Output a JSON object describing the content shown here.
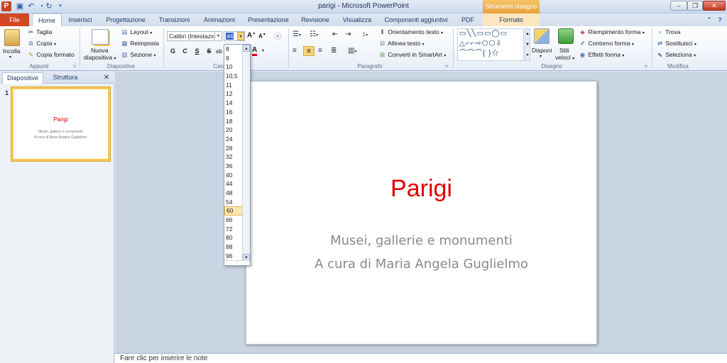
{
  "window": {
    "title": "parigi - Microsoft PowerPoint",
    "context_tool": "Strumenti disegno",
    "app_icon": "P"
  },
  "tabs": [
    "File",
    "Home",
    "Inserisci",
    "Progettazione",
    "Transizioni",
    "Animazioni",
    "Presentazione",
    "Revisione",
    "Visualizza",
    "Componenti aggiuntivi",
    "PDF",
    "Formato"
  ],
  "ribbon": {
    "clipboard": {
      "paste": "Incolla",
      "cut": "Taglia",
      "copy": "Copia",
      "format_painter": "Copia formato",
      "label": "Appunti"
    },
    "slides": {
      "new_slide_1": "Nuova",
      "new_slide_2": "diapositiva",
      "layout": "Layout",
      "reset": "Reimposta",
      "section": "Sezione",
      "label": "Diapositive"
    },
    "font": {
      "font_name": "Calibri (Intestazio",
      "font_size": "44",
      "bold": "G",
      "italic": "C",
      "underline": "S",
      "strike": "S",
      "shadow": "ab",
      "grow": "A",
      "shrink": "A",
      "color": "A",
      "label": "Carat"
    },
    "paragraph": {
      "text_direction": "Orientamento testo",
      "align_text": "Allinea testo",
      "smartart": "Converti in SmartArt",
      "label": "Paragrafo"
    },
    "drawing": {
      "arrange": "Disponi",
      "quick_styles_1": "Stili",
      "quick_styles_2": "veloci",
      "shape_fill": "Riempimento forma",
      "shape_outline": "Contorno forma",
      "shape_effects": "Effetti forma",
      "label": "Disegno"
    },
    "editing": {
      "find": "Trova",
      "replace": "Sostituisci",
      "select": "Seleziona",
      "label": "Modifica"
    }
  },
  "panel": {
    "tab_slides": "Diapositive",
    "tab_outline": "Struttura",
    "close_glyph": "✕",
    "thumb_number": "1",
    "thumb_title": "Parigi",
    "thumb_sub1": "Musei, gallerie e monumenti",
    "thumb_sub2": "A cura di Maria Angela Guglielmo"
  },
  "slide": {
    "title": "Parigi",
    "subtitle1": "Musei, gallerie e monumenti",
    "subtitle2": "A cura di Maria Angela Guglielmo"
  },
  "font_size_dropdown": {
    "items": [
      "8",
      "9",
      "10",
      "10,5",
      "11",
      "12",
      "14",
      "16",
      "18",
      "20",
      "24",
      "28",
      "32",
      "36",
      "40",
      "44",
      "48",
      "54",
      "60",
      "66",
      "72",
      "80",
      "88",
      "96"
    ],
    "selected": "60"
  },
  "notes": {
    "placeholder": "Fare clic per inserire le note"
  },
  "colors": {
    "title_red": "#e00000",
    "file_tab": "#d24726",
    "context_orange": "#e8a23a",
    "selection": "#fde6a7"
  }
}
